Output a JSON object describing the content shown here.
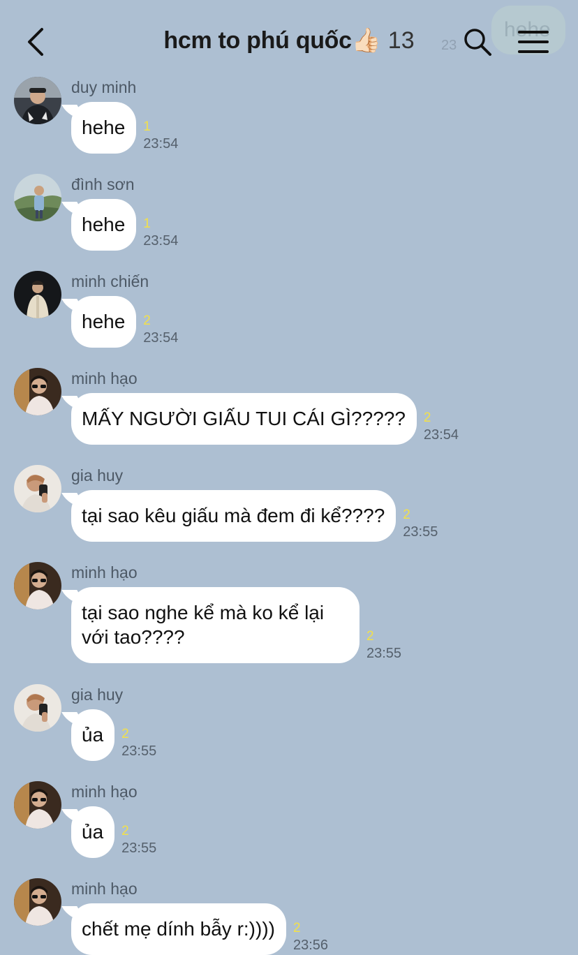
{
  "header": {
    "title": "hcm to phú quốc👍🏻",
    "member_count": "13",
    "icons": {
      "back": "back-chevron-icon",
      "search": "search-icon",
      "menu": "hamburger-menu-icon"
    }
  },
  "ghost_preview": {
    "text": "hehe",
    "time": "23"
  },
  "messages": [
    {
      "sender": "duy minh",
      "text": "hehe",
      "unread": "1",
      "time": "23:54"
    },
    {
      "sender": "đình sơn",
      "text": "hehe",
      "unread": "1",
      "time": "23:54"
    },
    {
      "sender": "minh chiến",
      "text": "hehe",
      "unread": "2",
      "time": "23:54"
    },
    {
      "sender": "minh hạo",
      "text": "MẤY NGƯỜI GIẤU TUI CÁI GÌ?????",
      "unread": "2",
      "time": "23:54"
    },
    {
      "sender": "gia huy",
      "text": "tại sao kêu giấu mà đem đi kể????",
      "unread": "2",
      "time": "23:55"
    },
    {
      "sender": "minh hạo",
      "text": "tại sao nghe kể mà ko kể lại với tao????",
      "unread": "2",
      "time": "23:55"
    },
    {
      "sender": "gia huy",
      "text": "ủa",
      "unread": "2",
      "time": "23:55"
    },
    {
      "sender": "minh hạo",
      "text": "ủa",
      "unread": "2",
      "time": "23:55"
    },
    {
      "sender": "minh hạo",
      "text": "chết mẹ dính bẫy r:))))",
      "unread": "2",
      "time": "23:56"
    }
  ],
  "colors": {
    "background": "#adbfd2",
    "bubble": "#ffffff",
    "unread": "#f2e04a"
  }
}
